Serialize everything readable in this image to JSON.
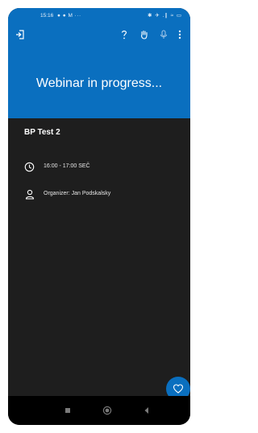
{
  "status_bar": {
    "time": "15:16",
    "left_icons": "● ● M ···",
    "right_icons": "✱ ✈ .∥ ≈ ▭"
  },
  "toolbar": {
    "icons": [
      "leave-icon",
      "help-icon",
      "raise-hand-icon",
      "microphone-icon",
      "more-vert-icon"
    ]
  },
  "banner": {
    "text": "Webinar in progress..."
  },
  "event": {
    "title": "BP Test 2",
    "time": "16:00 - 17:00 SEČ",
    "organizer": "Organizer: Jan Podskalsky"
  },
  "fab": {
    "icon": "heart-icon"
  },
  "nav_bar": {
    "icons": [
      "recents-icon",
      "home-icon",
      "back-icon"
    ]
  },
  "colors": {
    "accent": "#0a6fbf",
    "background": "#1e1e1e",
    "nav": "#000000"
  }
}
